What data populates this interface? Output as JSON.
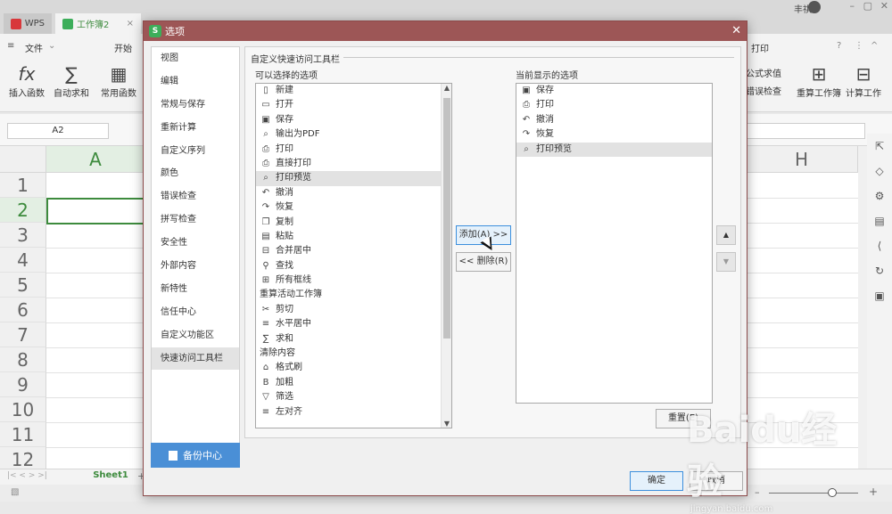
{
  "app": {
    "tabs": [
      {
        "label": "WPS"
      },
      {
        "label": "工作簿2"
      }
    ],
    "user_name": "丰祺"
  },
  "menu": {
    "file_label": "文件",
    "start_label": "开始",
    "search_text": "打印"
  },
  "ribbon": {
    "insert_function": "插入函数",
    "autosum": "自动求和",
    "common_function": "常用函数",
    "formula_eval": "公式求值",
    "error_check": "错误检查",
    "recalc_workbook": "重算工作簿",
    "calc_sheet": "计算工作"
  },
  "formula_bar": {
    "name_box": "A2"
  },
  "grid": {
    "columns": [
      "A",
      "H"
    ],
    "rows": [
      "1",
      "2",
      "3",
      "4",
      "5",
      "6",
      "7",
      "8",
      "9",
      "10",
      "11",
      "12"
    ]
  },
  "sheet": {
    "active_tab": "Sheet1"
  },
  "dialog": {
    "title": "选项",
    "nav_items": [
      "视图",
      "编辑",
      "常规与保存",
      "重新计算",
      "自定义序列",
      "颜色",
      "错误检查",
      "拼写检查",
      "安全性",
      "外部内容",
      "新特性",
      "信任中心",
      "自定义功能区",
      "快速访问工具栏"
    ],
    "active_nav": "快速访问工具栏",
    "backup_label": "备份中心",
    "section_title": "自定义快速访问工具栏",
    "available_label": "可以选择的选项",
    "current_label": "当前显示的选项",
    "available_items": [
      {
        "label": "新建",
        "icon": "new-doc-icon"
      },
      {
        "label": "打开",
        "icon": "open-folder-icon"
      },
      {
        "label": "保存",
        "icon": "save-icon"
      },
      {
        "label": "输出为PDF",
        "icon": "pdf-export-icon"
      },
      {
        "label": "打印",
        "icon": "print-icon"
      },
      {
        "label": "直接打印",
        "icon": "quick-print-icon"
      },
      {
        "label": "打印预览",
        "icon": "print-preview-icon"
      },
      {
        "label": "撤消",
        "icon": "undo-icon"
      },
      {
        "label": "恢复",
        "icon": "redo-icon"
      },
      {
        "label": "复制",
        "icon": "copy-icon"
      },
      {
        "label": "粘贴",
        "icon": "paste-icon"
      },
      {
        "label": "合并居中",
        "icon": "merge-center-icon"
      },
      {
        "label": "查找",
        "icon": "find-icon"
      },
      {
        "label": "所有框线",
        "icon": "all-borders-icon"
      },
      {
        "label": "重算活动工作簿",
        "icon": ""
      },
      {
        "label": "剪切",
        "icon": "cut-icon"
      },
      {
        "label": "水平居中",
        "icon": "align-center-icon"
      },
      {
        "label": "求和",
        "icon": "sum-icon"
      },
      {
        "label": "清除内容",
        "icon": ""
      },
      {
        "label": "格式刷",
        "icon": "format-painter-icon"
      },
      {
        "label": "加粗",
        "icon": "bold-icon"
      },
      {
        "label": "筛选",
        "icon": "filter-icon"
      },
      {
        "label": "左对齐",
        "icon": "align-left-icon"
      }
    ],
    "selected_available": "打印预览",
    "current_items": [
      {
        "label": "保存",
        "icon": "save-icon"
      },
      {
        "label": "打印",
        "icon": "print-icon"
      },
      {
        "label": "撤消",
        "icon": "undo-icon"
      },
      {
        "label": "恢复",
        "icon": "redo-icon"
      },
      {
        "label": "打印预览",
        "icon": "print-preview-icon"
      }
    ],
    "selected_current": "打印预览",
    "add_button": "添加(A) >>",
    "remove_button": "<< 删除(R)",
    "reset_button": "重置(E)",
    "ok_button": "确定",
    "cancel_button": "取消"
  },
  "watermark": {
    "line1": "Baidu经验",
    "line2": "jingyan.baidu.com"
  },
  "colors": {
    "dialog_title_bg": "#9d5656",
    "accent_green": "#3d8b3d",
    "backup_blue": "#4a8fd6",
    "focus_blue": "#3c8fdd"
  }
}
